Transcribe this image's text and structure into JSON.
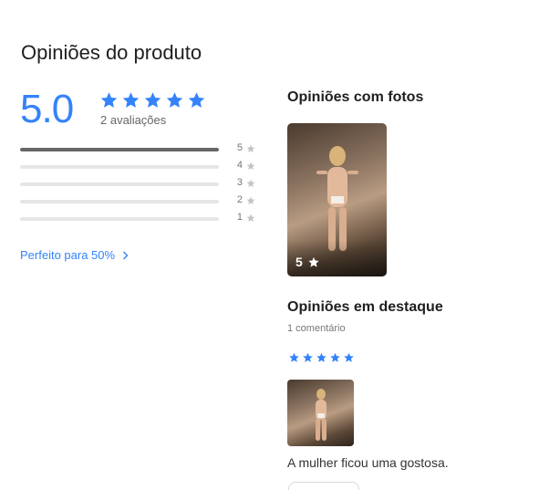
{
  "header": {
    "title": "Opiniões do produto"
  },
  "summary": {
    "score": "5.0",
    "stars": 5,
    "count_text": "2 avaliações",
    "star_color": "#3483fa"
  },
  "distribution": [
    {
      "stars": "5",
      "fraction": 1.0
    },
    {
      "stars": "4",
      "fraction": 0.0
    },
    {
      "stars": "3",
      "fraction": 0.0
    },
    {
      "stars": "2",
      "fraction": 0.0
    },
    {
      "stars": "1",
      "fraction": 0.0
    }
  ],
  "link": {
    "label": "Perfeito para 50%",
    "icon": "chevron-right-icon"
  },
  "photos": {
    "title": "Opiniões com fotos",
    "items": [
      {
        "rating": "5",
        "icon": "star-icon"
      }
    ]
  },
  "featured": {
    "title": "Opiniões em destaque",
    "comments": "1 comentário",
    "review": {
      "stars": 5,
      "text": "A mulher ficou uma gostosa."
    }
  },
  "colors": {
    "accent": "#3483fa",
    "bar_fill": "#666666",
    "bar_track": "#e6e6e6"
  }
}
